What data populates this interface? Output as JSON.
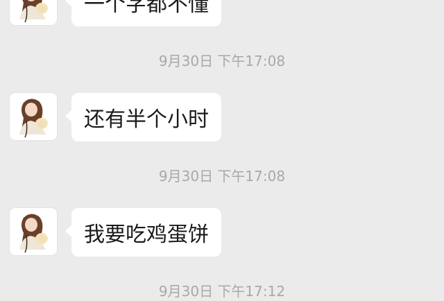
{
  "conversation": {
    "messages": [
      {
        "text": "一个字都不懂",
        "avatar_icon": "avatar-anime-girl-icon"
      },
      {
        "text": "还有半个小时",
        "avatar_icon": "avatar-anime-girl-icon"
      },
      {
        "text": "我要吃鸡蛋饼",
        "avatar_icon": "avatar-anime-girl-icon"
      }
    ],
    "timestamps": [
      "9月30日 下午17:08",
      "9月30日 下午17:08",
      "9月30日 下午17:12"
    ]
  },
  "colors": {
    "background": "#ebebeb",
    "bubble": "#ffffff",
    "timestamp_text": "#a8a8a8",
    "message_text": "#1a1a1a"
  }
}
